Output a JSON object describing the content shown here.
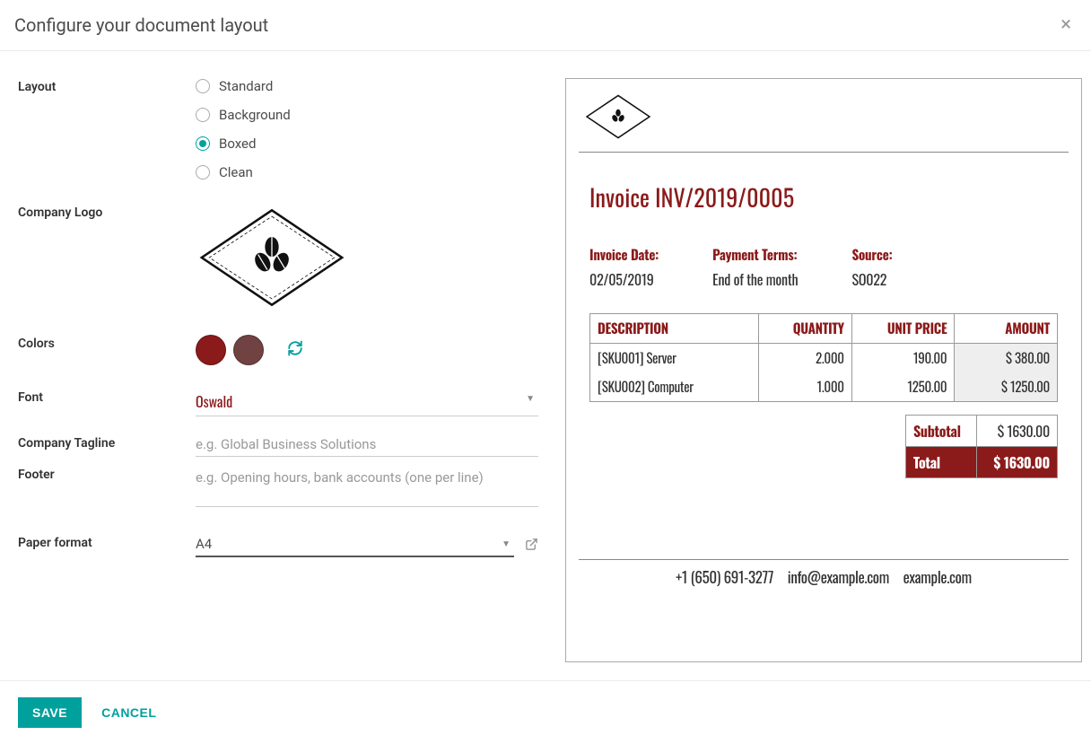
{
  "modal": {
    "title": "Configure your document layout"
  },
  "form": {
    "layout_label": "Layout",
    "layout_options": {
      "standard": "Standard",
      "background": "Background",
      "boxed": "Boxed",
      "clean": "Clean",
      "selected": "boxed"
    },
    "logo_label": "Company Logo",
    "colors_label": "Colors",
    "colors": {
      "primary": "#8B1A1A",
      "secondary": "#704242"
    },
    "font_label": "Font",
    "font_value": "Oswald",
    "tagline_label": "Company Tagline",
    "tagline_placeholder": "e.g. Global Business Solutions",
    "footer_label": "Footer",
    "footer_placeholder": "e.g. Opening hours, bank accounts (one per line)",
    "paper_label": "Paper format",
    "paper_value": "A4"
  },
  "preview": {
    "title": "Invoice INV/2019/0005",
    "meta": {
      "date_label": "Invoice Date:",
      "date_value": "02/05/2019",
      "terms_label": "Payment Terms:",
      "terms_value": "End of the month",
      "source_label": "Source:",
      "source_value": "SO022"
    },
    "table": {
      "headers": {
        "desc": "DESCRIPTION",
        "qty": "QUANTITY",
        "unit": "UNIT PRICE",
        "amt": "AMOUNT"
      },
      "rows": [
        {
          "desc": "[SKU001] Server",
          "qty": "2.000",
          "unit": "190.00",
          "amt": "$ 380.00"
        },
        {
          "desc": "[SKU002] Computer",
          "qty": "1.000",
          "unit": "1250.00",
          "amt": "$ 1250.00"
        }
      ]
    },
    "totals": {
      "subtotal_label": "Subtotal",
      "subtotal_value": "$ 1630.00",
      "total_label": "Total",
      "total_value": "$ 1630.00"
    },
    "footer": {
      "phone": "+1 (650) 691-3277",
      "email": "info@example.com",
      "site": "example.com"
    }
  },
  "buttons": {
    "save": "SAVE",
    "cancel": "CANCEL"
  }
}
